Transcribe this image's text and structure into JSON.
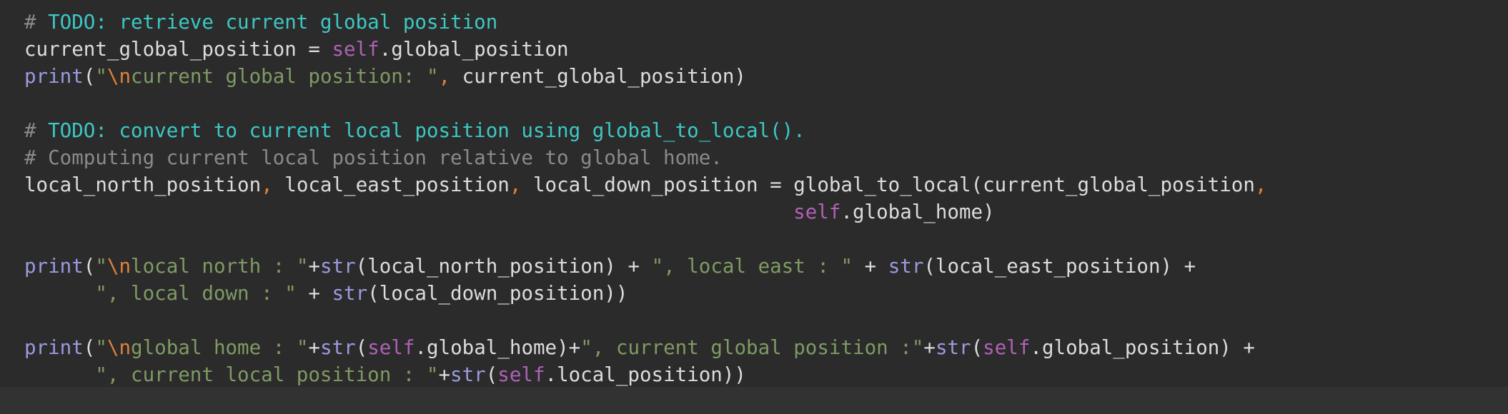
{
  "colors": {
    "background": "#2b2b2b",
    "footer": "#323232",
    "plain": "#dcdcdc",
    "comment": "#8a8a8a",
    "todo": "#3cc8c4",
    "self_keyword": "#b061b4",
    "builtin": "#9a9ae0",
    "string": "#7f9a63",
    "escape_and_comma": "#e0813a"
  },
  "code": {
    "lines": [
      [
        {
          "t": "# ",
          "k": "cmt"
        },
        {
          "t": "TODO: retrieve current global position",
          "k": "todo"
        }
      ],
      [
        {
          "t": "current_global_position = ",
          "k": "plain"
        },
        {
          "t": "self",
          "k": "self"
        },
        {
          "t": ".global_position",
          "k": "plain"
        }
      ],
      [
        {
          "t": "print",
          "k": "builtin"
        },
        {
          "t": "(",
          "k": "plain"
        },
        {
          "t": "\"",
          "k": "str"
        },
        {
          "t": "\\n",
          "k": "esc"
        },
        {
          "t": "current global position: \"",
          "k": "str"
        },
        {
          "t": ",",
          "k": "comma"
        },
        {
          "t": " current_global_position)",
          "k": "plain"
        }
      ],
      [],
      [
        {
          "t": "# ",
          "k": "cmt"
        },
        {
          "t": "TODO: convert to current local position using global_to_local().",
          "k": "todo"
        }
      ],
      [
        {
          "t": "# Computing current local position relative to global home.",
          "k": "cmt"
        }
      ],
      [
        {
          "t": "local_north_position",
          "k": "plain"
        },
        {
          "t": ",",
          "k": "comma"
        },
        {
          "t": " local_east_position",
          "k": "plain"
        },
        {
          "t": ",",
          "k": "comma"
        },
        {
          "t": " local_down_position = global_to_local(current_global_position",
          "k": "plain"
        },
        {
          "t": ",",
          "k": "comma"
        }
      ],
      [
        {
          "t": "                                                                 ",
          "k": "plain"
        },
        {
          "t": "self",
          "k": "self"
        },
        {
          "t": ".global_home)",
          "k": "plain"
        }
      ],
      [],
      [
        {
          "t": "print",
          "k": "builtin"
        },
        {
          "t": "(",
          "k": "plain"
        },
        {
          "t": "\"",
          "k": "str"
        },
        {
          "t": "\\n",
          "k": "esc"
        },
        {
          "t": "local north : \"",
          "k": "str"
        },
        {
          "t": "+",
          "k": "plain"
        },
        {
          "t": "str",
          "k": "builtin"
        },
        {
          "t": "(local_north_position) + ",
          "k": "plain"
        },
        {
          "t": "\", local east : \"",
          "k": "str"
        },
        {
          "t": " + ",
          "k": "plain"
        },
        {
          "t": "str",
          "k": "builtin"
        },
        {
          "t": "(local_east_position) +",
          "k": "plain"
        }
      ],
      [
        {
          "t": "      ",
          "k": "plain"
        },
        {
          "t": "\", local down : \"",
          "k": "str"
        },
        {
          "t": " + ",
          "k": "plain"
        },
        {
          "t": "str",
          "k": "builtin"
        },
        {
          "t": "(local_down_position))",
          "k": "plain"
        }
      ],
      [],
      [
        {
          "t": "print",
          "k": "builtin"
        },
        {
          "t": "(",
          "k": "plain"
        },
        {
          "t": "\"",
          "k": "str"
        },
        {
          "t": "\\n",
          "k": "esc"
        },
        {
          "t": "global home : \"",
          "k": "str"
        },
        {
          "t": "+",
          "k": "plain"
        },
        {
          "t": "str",
          "k": "builtin"
        },
        {
          "t": "(",
          "k": "plain"
        },
        {
          "t": "self",
          "k": "self"
        },
        {
          "t": ".global_home)+",
          "k": "plain"
        },
        {
          "t": "\", current global position :\"",
          "k": "str"
        },
        {
          "t": "+",
          "k": "plain"
        },
        {
          "t": "str",
          "k": "builtin"
        },
        {
          "t": "(",
          "k": "plain"
        },
        {
          "t": "self",
          "k": "self"
        },
        {
          "t": ".global_position) +",
          "k": "plain"
        }
      ],
      [
        {
          "t": "      ",
          "k": "plain"
        },
        {
          "t": "\", current local position : \"",
          "k": "str"
        },
        {
          "t": "+",
          "k": "plain"
        },
        {
          "t": "str",
          "k": "builtin"
        },
        {
          "t": "(",
          "k": "plain"
        },
        {
          "t": "self",
          "k": "self"
        },
        {
          "t": ".local_position))",
          "k": "plain"
        }
      ]
    ]
  }
}
